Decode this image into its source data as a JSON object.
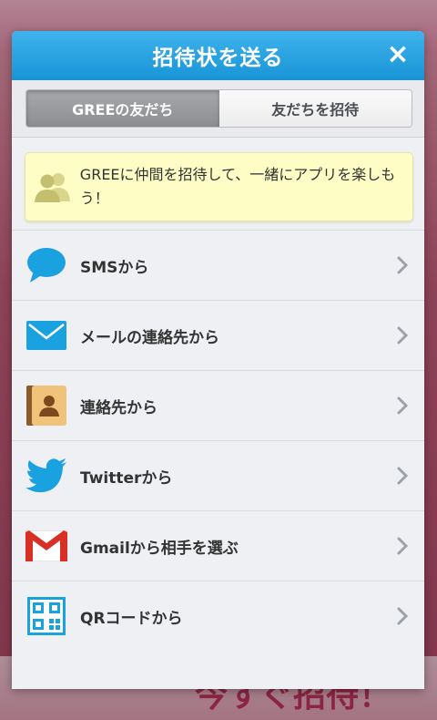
{
  "dialog": {
    "title": "招待状を送る",
    "close_label": "×"
  },
  "tabs": [
    {
      "label": "GREEの友だち",
      "active": true
    },
    {
      "label": "友だちを招待",
      "active": false
    }
  ],
  "banner": {
    "icon": "friends-icon",
    "text": "GREEに仲間を招待して、一緒にアプリを楽しもう！"
  },
  "options": [
    {
      "label": "SMSから",
      "icon": "sms-bubble-icon"
    },
    {
      "label": "メールの連絡先から",
      "icon": "mail-envelope-icon"
    },
    {
      "label": "連絡先から",
      "icon": "contacts-book-icon"
    },
    {
      "label": "Twitterから",
      "icon": "twitter-bird-icon"
    },
    {
      "label": "Gmailから相手を選ぶ",
      "icon": "gmail-icon"
    },
    {
      "label": "QRコードから",
      "icon": "qr-code-icon"
    }
  ],
  "background": {
    "bottom_text": "今すぐ招待！"
  },
  "colors": {
    "header": "#1894d6",
    "accent_blue": "#1aa1e0",
    "banner": "#fefdc6",
    "gmail_red": "#d93025"
  }
}
